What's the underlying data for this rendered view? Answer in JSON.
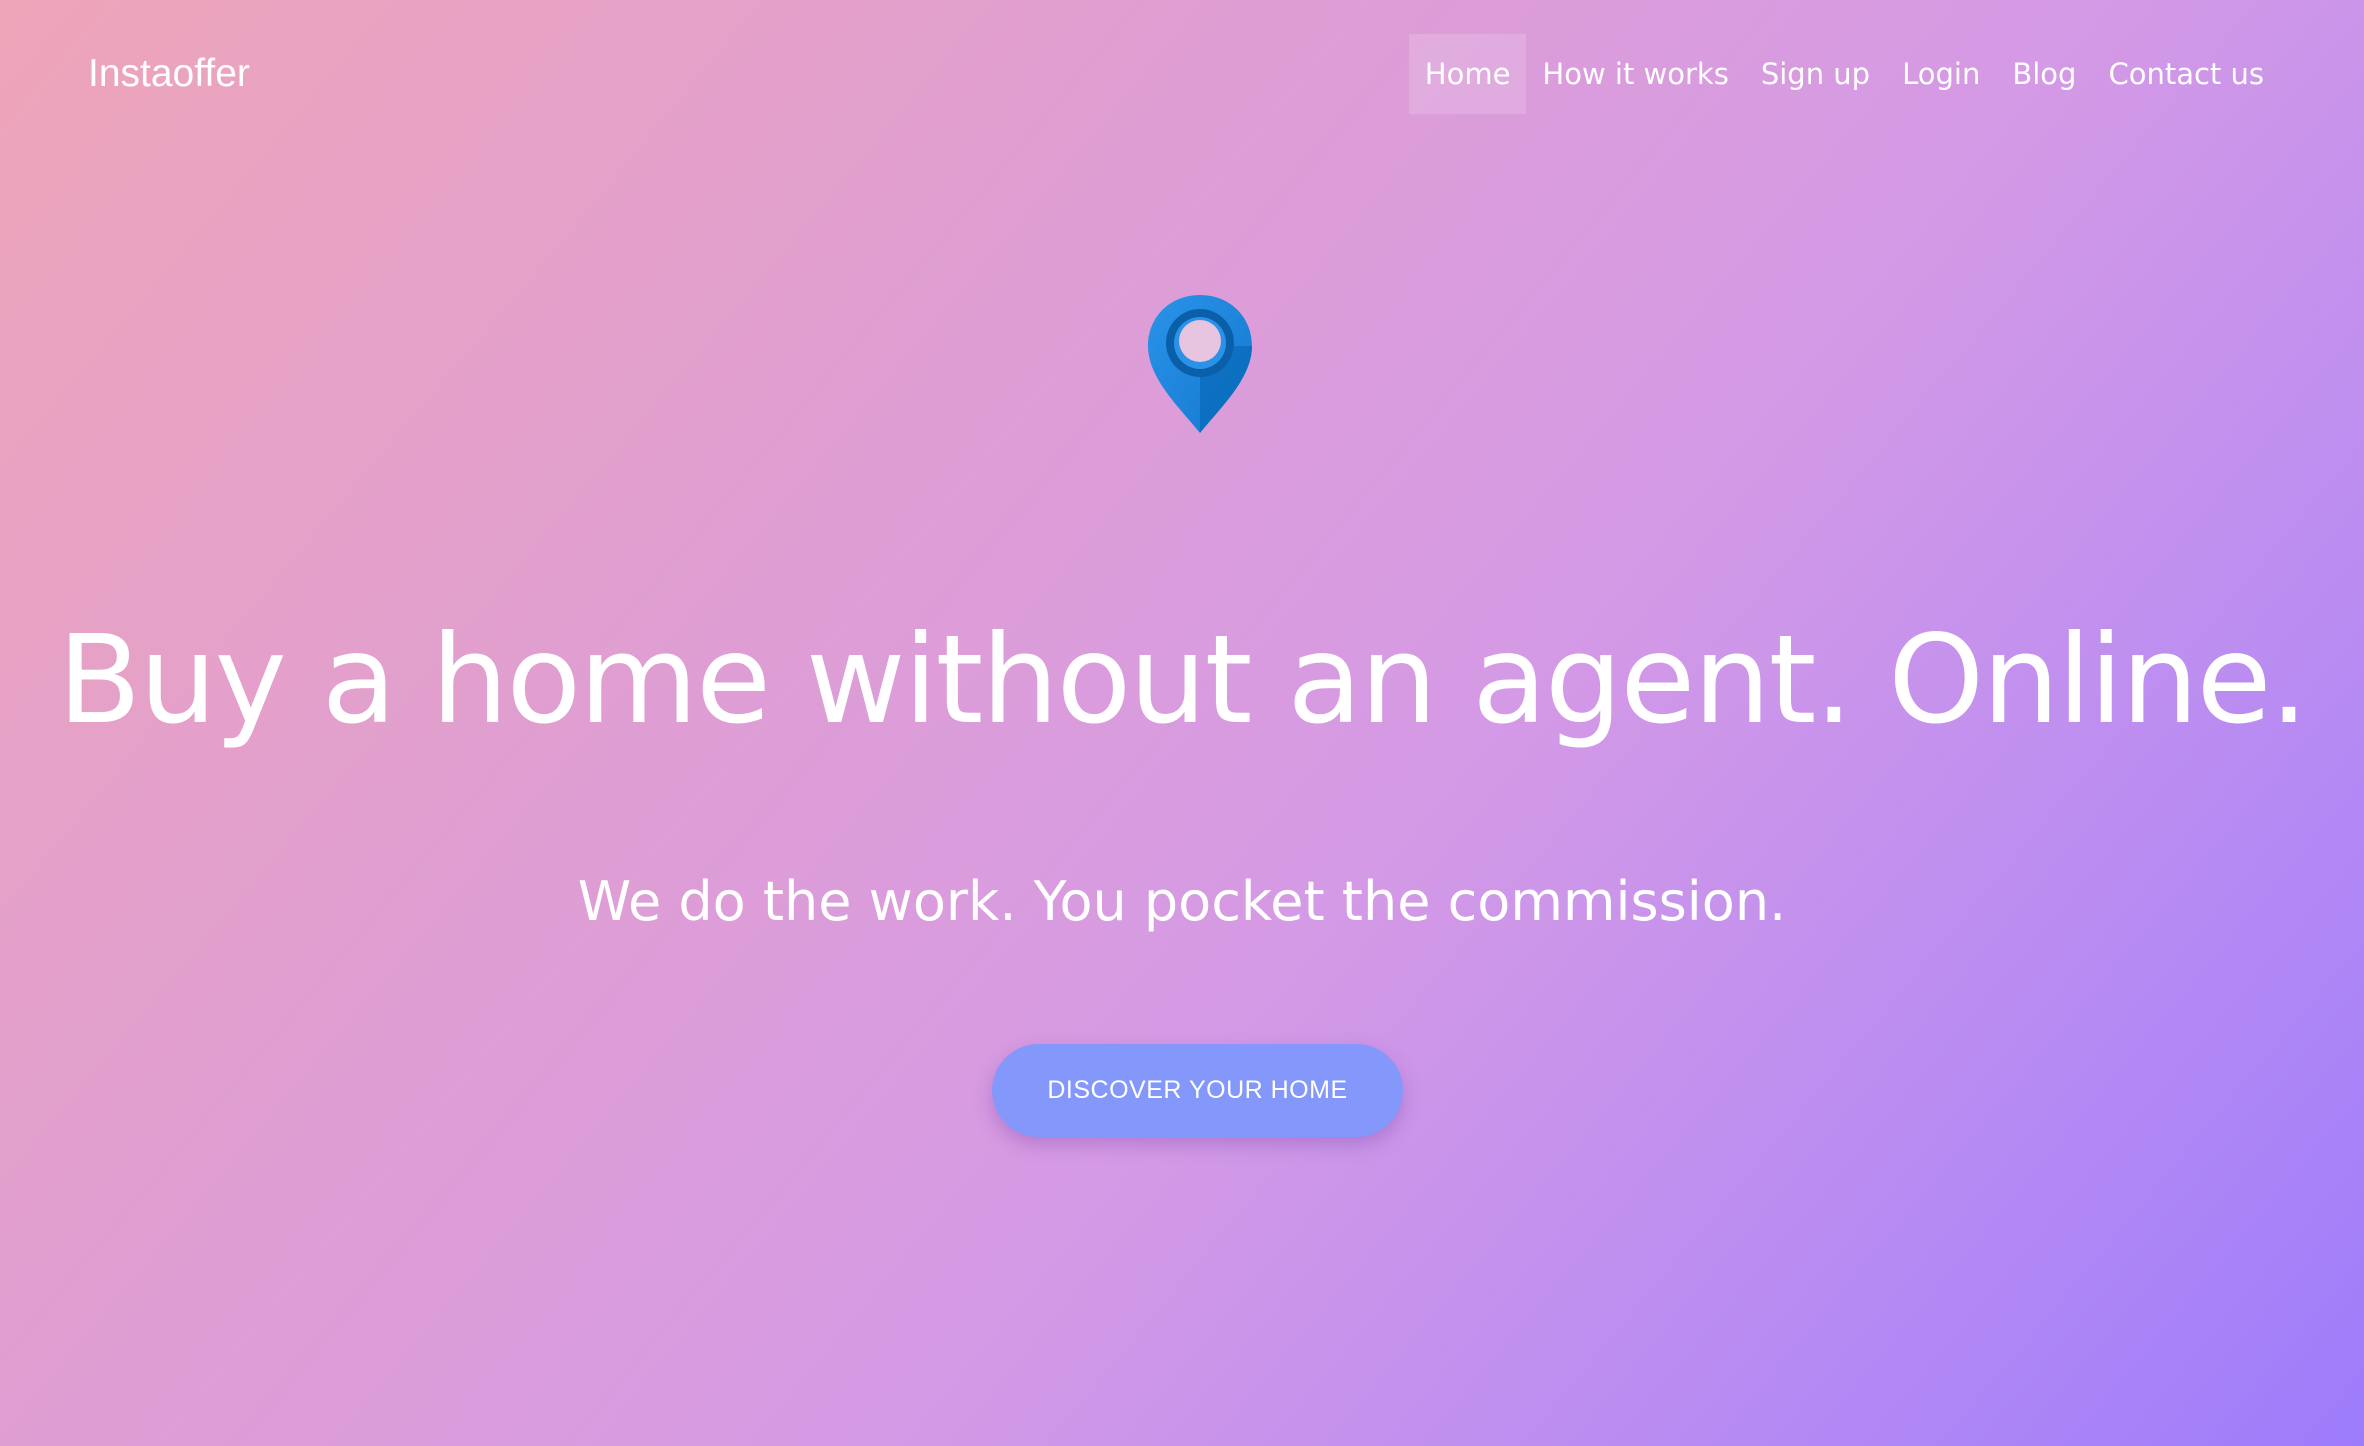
{
  "navbar": {
    "brand": "Instaoffer",
    "items": [
      {
        "label": "Home",
        "active": true
      },
      {
        "label": "How it works",
        "active": false
      },
      {
        "label": "Sign up",
        "active": false
      },
      {
        "label": "Login",
        "active": false
      },
      {
        "label": "Blog",
        "active": false
      },
      {
        "label": "Contact us",
        "active": false
      }
    ]
  },
  "hero": {
    "icon": "map-pin-icon",
    "headline": "Buy a home without an agent. Online.",
    "subheadline": "We do the work. You pocket the commission.",
    "cta_label": "DISCOVER YOUR HOME"
  },
  "colors": {
    "gradient_start": "#eea5b9",
    "gradient_mid": "#d59ae5",
    "gradient_end": "#9d7cfb",
    "button": "#8498fc",
    "pin_light": "#2a93e8",
    "pin_dark": "#0a5fa8",
    "text": "#ffffff"
  }
}
